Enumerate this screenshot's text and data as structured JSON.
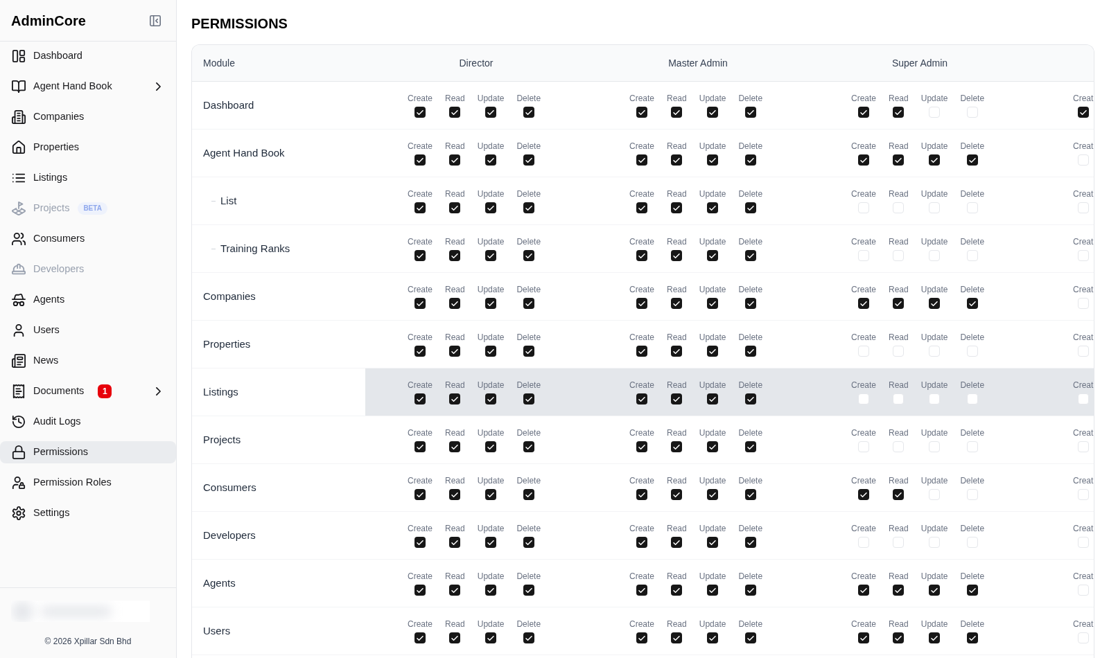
{
  "sidebar": {
    "brand": "AdminCore",
    "items": [
      {
        "label": "Dashboard",
        "kind": "link",
        "selected": false,
        "disabled": false
      },
      {
        "label": "Agent Hand Book",
        "kind": "group",
        "selected": false,
        "disabled": false
      },
      {
        "label": "Companies",
        "kind": "link",
        "selected": false,
        "disabled": false
      },
      {
        "label": "Properties",
        "kind": "link",
        "selected": false,
        "disabled": false
      },
      {
        "label": "Listings",
        "kind": "link",
        "selected": false,
        "disabled": false
      },
      {
        "label": "Projects",
        "kind": "link",
        "selected": false,
        "disabled": true,
        "badge": {
          "kind": "beta",
          "text": "BETA"
        }
      },
      {
        "label": "Consumers",
        "kind": "link",
        "selected": false,
        "disabled": false
      },
      {
        "label": "Developers",
        "kind": "link",
        "selected": false,
        "disabled": true
      },
      {
        "label": "Agents",
        "kind": "link",
        "selected": false,
        "disabled": false
      },
      {
        "label": "Users",
        "kind": "link",
        "selected": false,
        "disabled": false
      },
      {
        "label": "News",
        "kind": "link",
        "selected": false,
        "disabled": false
      },
      {
        "label": "Documents",
        "kind": "group",
        "selected": false,
        "disabled": false,
        "badge": {
          "kind": "count",
          "text": "1"
        }
      },
      {
        "label": "Audit Logs",
        "kind": "link",
        "selected": false,
        "disabled": false
      },
      {
        "label": "Permissions",
        "kind": "link",
        "selected": true,
        "disabled": false
      },
      {
        "label": "Permission Roles",
        "kind": "link",
        "selected": false,
        "disabled": false
      },
      {
        "label": "Settings",
        "kind": "link",
        "selected": false,
        "disabled": false
      }
    ],
    "footer": {
      "copyright": "© 2026 Xpillar Sdn Bhd"
    }
  },
  "page": {
    "title": "PERMISSIONS"
  },
  "table": {
    "columns": [
      "Module",
      "Director",
      "Master Admin",
      "Super Admin"
    ],
    "rows": [
      {
        "module": "Dashboard",
        "highlighted": false,
        "permissions": [
          [
            {
              "label": "Create",
              "checked": true
            },
            {
              "label": "Read",
              "checked": true
            },
            {
              "label": "Update",
              "checked": true
            },
            {
              "label": "Delete",
              "checked": true
            }
          ],
          [
            {
              "label": "Create",
              "checked": true
            },
            {
              "label": "Read",
              "checked": true
            },
            {
              "label": "Update",
              "checked": true
            },
            {
              "label": "Delete",
              "checked": true
            }
          ],
          [
            {
              "label": "Create",
              "checked": true
            },
            {
              "label": "Read",
              "checked": true
            },
            {
              "label": "Update",
              "checked": false
            },
            {
              "label": "Delete",
              "checked": false
            }
          ],
          [
            {
              "label": "Creat",
              "checked": true
            }
          ]
        ]
      },
      {
        "module": "Agent Hand Book",
        "highlighted": false,
        "permissions": [
          [
            {
              "label": "Create",
              "checked": true
            },
            {
              "label": "Read",
              "checked": true
            },
            {
              "label": "Update",
              "checked": true
            },
            {
              "label": "Delete",
              "checked": true
            }
          ],
          [
            {
              "label": "Create",
              "checked": true
            },
            {
              "label": "Read",
              "checked": true
            },
            {
              "label": "Update",
              "checked": true
            },
            {
              "label": "Delete",
              "checked": true
            }
          ],
          [
            {
              "label": "Create",
              "checked": true
            },
            {
              "label": "Read",
              "checked": true
            },
            {
              "label": "Update",
              "checked": true
            },
            {
              "label": "Delete",
              "checked": true
            }
          ],
          [
            {
              "label": "Creat",
              "checked": false
            }
          ]
        ],
        "children": [
          {
            "module": "List",
            "highlighted": false,
            "permissions": [
              [
                {
                  "label": "Create",
                  "checked": true
                },
                {
                  "label": "Read",
                  "checked": true
                },
                {
                  "label": "Update",
                  "checked": true
                },
                {
                  "label": "Delete",
                  "checked": true
                }
              ],
              [
                {
                  "label": "Create",
                  "checked": true
                },
                {
                  "label": "Read",
                  "checked": true
                },
                {
                  "label": "Update",
                  "checked": true
                },
                {
                  "label": "Delete",
                  "checked": true
                }
              ],
              [
                {
                  "label": "Create",
                  "checked": false
                },
                {
                  "label": "Read",
                  "checked": false
                },
                {
                  "label": "Update",
                  "checked": false
                },
                {
                  "label": "Delete",
                  "checked": false
                }
              ],
              [
                {
                  "label": "Creat",
                  "checked": false
                }
              ]
            ]
          },
          {
            "module": "Training Ranks",
            "highlighted": false,
            "permissions": [
              [
                {
                  "label": "Create",
                  "checked": true
                },
                {
                  "label": "Read",
                  "checked": true
                },
                {
                  "label": "Update",
                  "checked": true
                },
                {
                  "label": "Delete",
                  "checked": true
                }
              ],
              [
                {
                  "label": "Create",
                  "checked": true
                },
                {
                  "label": "Read",
                  "checked": true
                },
                {
                  "label": "Update",
                  "checked": true
                },
                {
                  "label": "Delete",
                  "checked": true
                }
              ],
              [
                {
                  "label": "Create",
                  "checked": false
                },
                {
                  "label": "Read",
                  "checked": false
                },
                {
                  "label": "Update",
                  "checked": false
                },
                {
                  "label": "Delete",
                  "checked": false
                }
              ],
              [
                {
                  "label": "Creat",
                  "checked": false
                }
              ]
            ]
          }
        ]
      },
      {
        "module": "Companies",
        "highlighted": false,
        "permissions": [
          [
            {
              "label": "Create",
              "checked": true
            },
            {
              "label": "Read",
              "checked": true
            },
            {
              "label": "Update",
              "checked": true
            },
            {
              "label": "Delete",
              "checked": true
            }
          ],
          [
            {
              "label": "Create",
              "checked": true
            },
            {
              "label": "Read",
              "checked": true
            },
            {
              "label": "Update",
              "checked": true
            },
            {
              "label": "Delete",
              "checked": true
            }
          ],
          [
            {
              "label": "Create",
              "checked": true
            },
            {
              "label": "Read",
              "checked": true
            },
            {
              "label": "Update",
              "checked": true
            },
            {
              "label": "Delete",
              "checked": true
            }
          ],
          [
            {
              "label": "Creat",
              "checked": false
            }
          ]
        ]
      },
      {
        "module": "Properties",
        "highlighted": false,
        "permissions": [
          [
            {
              "label": "Create",
              "checked": true
            },
            {
              "label": "Read",
              "checked": true
            },
            {
              "label": "Update",
              "checked": true
            },
            {
              "label": "Delete",
              "checked": true
            }
          ],
          [
            {
              "label": "Create",
              "checked": true
            },
            {
              "label": "Read",
              "checked": true
            },
            {
              "label": "Update",
              "checked": true
            },
            {
              "label": "Delete",
              "checked": true
            }
          ],
          [
            {
              "label": "Create",
              "checked": false
            },
            {
              "label": "Read",
              "checked": false
            },
            {
              "label": "Update",
              "checked": false
            },
            {
              "label": "Delete",
              "checked": false
            }
          ],
          [
            {
              "label": "Creat",
              "checked": false
            }
          ]
        ]
      },
      {
        "module": "Listings",
        "highlighted": true,
        "permissions": [
          [
            {
              "label": "Create",
              "checked": true
            },
            {
              "label": "Read",
              "checked": true
            },
            {
              "label": "Update",
              "checked": true
            },
            {
              "label": "Delete",
              "checked": true
            }
          ],
          [
            {
              "label": "Create",
              "checked": true
            },
            {
              "label": "Read",
              "checked": true
            },
            {
              "label": "Update",
              "checked": true
            },
            {
              "label": "Delete",
              "checked": true
            }
          ],
          [
            {
              "label": "Create",
              "checked": false
            },
            {
              "label": "Read",
              "checked": false
            },
            {
              "label": "Update",
              "checked": false
            },
            {
              "label": "Delete",
              "checked": false
            }
          ],
          [
            {
              "label": "Creat",
              "checked": false
            }
          ]
        ]
      },
      {
        "module": "Projects",
        "highlighted": false,
        "permissions": [
          [
            {
              "label": "Create",
              "checked": true
            },
            {
              "label": "Read",
              "checked": true
            },
            {
              "label": "Update",
              "checked": true
            },
            {
              "label": "Delete",
              "checked": true
            }
          ],
          [
            {
              "label": "Create",
              "checked": true
            },
            {
              "label": "Read",
              "checked": true
            },
            {
              "label": "Update",
              "checked": true
            },
            {
              "label": "Delete",
              "checked": true
            }
          ],
          [
            {
              "label": "Create",
              "checked": false
            },
            {
              "label": "Read",
              "checked": false
            },
            {
              "label": "Update",
              "checked": false
            },
            {
              "label": "Delete",
              "checked": false
            }
          ],
          [
            {
              "label": "Creat",
              "checked": false
            }
          ]
        ]
      },
      {
        "module": "Consumers",
        "highlighted": false,
        "permissions": [
          [
            {
              "label": "Create",
              "checked": true
            },
            {
              "label": "Read",
              "checked": true
            },
            {
              "label": "Update",
              "checked": true
            },
            {
              "label": "Delete",
              "checked": true
            }
          ],
          [
            {
              "label": "Create",
              "checked": true
            },
            {
              "label": "Read",
              "checked": true
            },
            {
              "label": "Update",
              "checked": true
            },
            {
              "label": "Delete",
              "checked": true
            }
          ],
          [
            {
              "label": "Create",
              "checked": true
            },
            {
              "label": "Read",
              "checked": true
            },
            {
              "label": "Update",
              "checked": false
            },
            {
              "label": "Delete",
              "checked": false
            }
          ],
          [
            {
              "label": "Creat",
              "checked": false
            }
          ]
        ]
      },
      {
        "module": "Developers",
        "highlighted": false,
        "permissions": [
          [
            {
              "label": "Create",
              "checked": true
            },
            {
              "label": "Read",
              "checked": true
            },
            {
              "label": "Update",
              "checked": true
            },
            {
              "label": "Delete",
              "checked": true
            }
          ],
          [
            {
              "label": "Create",
              "checked": true
            },
            {
              "label": "Read",
              "checked": true
            },
            {
              "label": "Update",
              "checked": true
            },
            {
              "label": "Delete",
              "checked": true
            }
          ],
          [
            {
              "label": "Create",
              "checked": false
            },
            {
              "label": "Read",
              "checked": false
            },
            {
              "label": "Update",
              "checked": false
            },
            {
              "label": "Delete",
              "checked": false
            }
          ],
          [
            {
              "label": "Creat",
              "checked": false
            }
          ]
        ]
      },
      {
        "module": "Agents",
        "highlighted": false,
        "permissions": [
          [
            {
              "label": "Create",
              "checked": true
            },
            {
              "label": "Read",
              "checked": true
            },
            {
              "label": "Update",
              "checked": true
            },
            {
              "label": "Delete",
              "checked": true
            }
          ],
          [
            {
              "label": "Create",
              "checked": true
            },
            {
              "label": "Read",
              "checked": true
            },
            {
              "label": "Update",
              "checked": true
            },
            {
              "label": "Delete",
              "checked": true
            }
          ],
          [
            {
              "label": "Create",
              "checked": true
            },
            {
              "label": "Read",
              "checked": true
            },
            {
              "label": "Update",
              "checked": true
            },
            {
              "label": "Delete",
              "checked": true
            }
          ],
          [
            {
              "label": "Creat",
              "checked": false
            }
          ]
        ]
      },
      {
        "module": "Users",
        "highlighted": false,
        "permissions": [
          [
            {
              "label": "Create",
              "checked": true
            },
            {
              "label": "Read",
              "checked": true
            },
            {
              "label": "Update",
              "checked": true
            },
            {
              "label": "Delete",
              "checked": true
            }
          ],
          [
            {
              "label": "Create",
              "checked": true
            },
            {
              "label": "Read",
              "checked": true
            },
            {
              "label": "Update",
              "checked": true
            },
            {
              "label": "Delete",
              "checked": true
            }
          ],
          [
            {
              "label": "Create",
              "checked": true
            },
            {
              "label": "Read",
              "checked": true
            },
            {
              "label": "Update",
              "checked": true
            },
            {
              "label": "Delete",
              "checked": true
            }
          ],
          [
            {
              "label": "Creat",
              "checked": false
            }
          ]
        ]
      }
    ]
  }
}
